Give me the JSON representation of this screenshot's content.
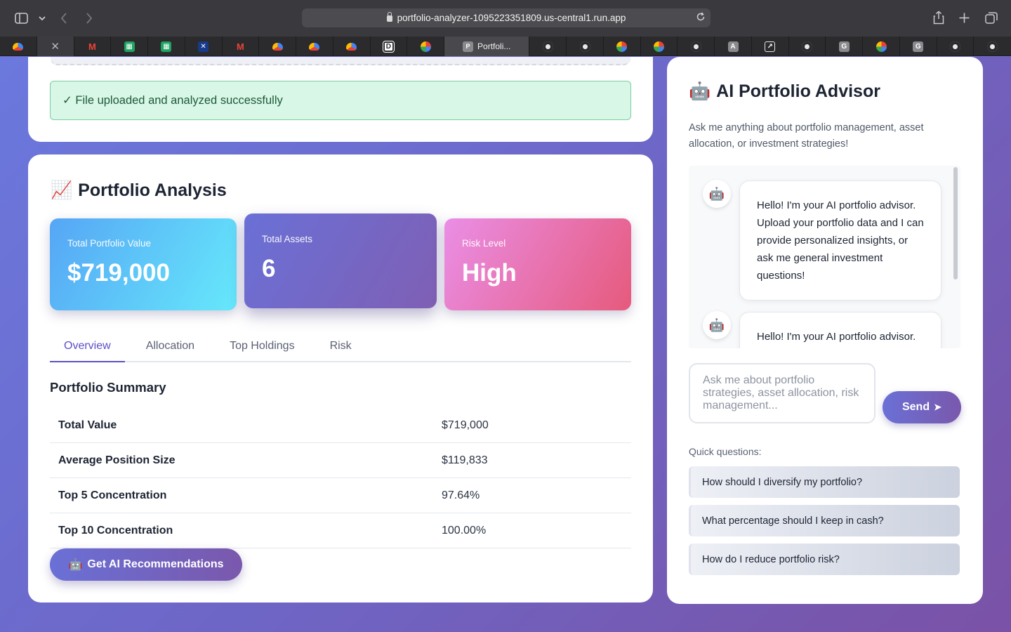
{
  "browser": {
    "url": "portfolio-analyzer-1095223351809.us-central1.run.app",
    "active_tab_title": "Portfoli...",
    "active_tab_letter": "P",
    "close_glyph": "✕"
  },
  "upload": {
    "success_message": "✓ File uploaded and analyzed successfully"
  },
  "analysis": {
    "icon": "📈",
    "title": "Portfolio Analysis",
    "stats": [
      {
        "label": "Total Portfolio Value",
        "value": "$719,000"
      },
      {
        "label": "Total Assets",
        "value": "6"
      },
      {
        "label": "Risk Level",
        "value": "High"
      }
    ],
    "tabs": [
      "Overview",
      "Allocation",
      "Top Holdings",
      "Risk"
    ],
    "active_tab": "Overview",
    "summary_title": "Portfolio Summary",
    "summary_rows": [
      {
        "label": "Total Value",
        "value": "$719,000"
      },
      {
        "label": "Average Position Size",
        "value": "$119,833"
      },
      {
        "label": "Top 5 Concentration",
        "value": "97.64%"
      },
      {
        "label": "Top 10 Concentration",
        "value": "100.00%"
      }
    ],
    "ai_button_icon": "🤖",
    "ai_button_label": "Get AI Recommendations"
  },
  "advisor": {
    "icon": "🤖",
    "title": "AI Portfolio Advisor",
    "description": "Ask me anything about portfolio management, asset allocation, or investment strategies!",
    "messages": [
      {
        "avatar": "🤖",
        "text": "Hello! I'm your AI portfolio advisor. Upload your portfolio data and I can provide personalized insights, or ask me general investment questions!"
      },
      {
        "avatar": "🤖",
        "text": "Hello! I'm your AI portfolio advisor. Upload your portfolio data and I can provide personalized insights, or ask me general investment questions!"
      }
    ],
    "input_placeholder": "Ask me about portfolio strategies, asset allocation, risk management...",
    "send_label": "Send",
    "send_icon": "➤",
    "quick_label": "Quick questions:",
    "quick_questions": [
      "How should I diversify my portfolio?",
      "What percentage should I keep in cash?",
      "How do I reduce portfolio risk?"
    ]
  },
  "colors": {
    "accent": "#5a4fc7",
    "success_bg": "#d9f7e7",
    "success_border": "#7ccca3"
  }
}
